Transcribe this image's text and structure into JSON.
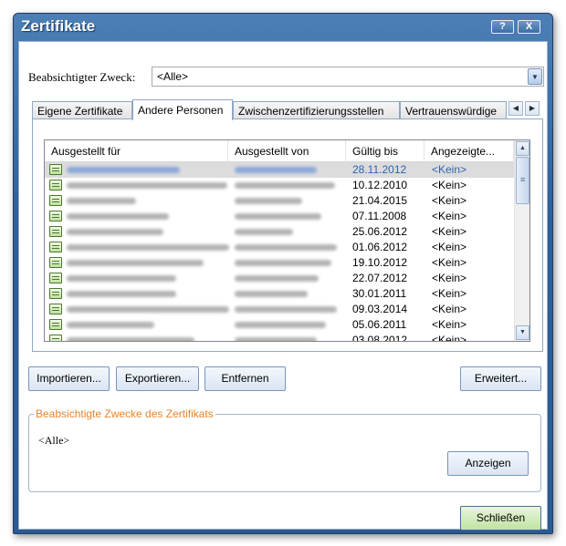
{
  "window": {
    "title": "Zertifikate",
    "help_btn": "?",
    "close_btn": "X"
  },
  "purpose": {
    "label": "Beabsichtigter Zweck:",
    "selected": "<Alle>"
  },
  "tabs": [
    {
      "label": "Eigene Zertifikate"
    },
    {
      "label": "Andere Personen"
    },
    {
      "label": "Zwischenzertifizierungsstellen"
    },
    {
      "label": "Vertrauenswürdige"
    }
  ],
  "list": {
    "columns": [
      "Ausgestellt für",
      "Ausgestellt von",
      "Gültig bis",
      "Angezeigte..."
    ],
    "rows": [
      {
        "valid_until": "28.11.2012",
        "friendly": "<Kein>"
      },
      {
        "valid_until": "10.12.2010",
        "friendly": "<Kein>"
      },
      {
        "valid_until": "21.04.2015",
        "friendly": "<Kein>"
      },
      {
        "valid_until": "07.11.2008",
        "friendly": "<Kein>"
      },
      {
        "valid_until": "25.06.2012",
        "friendly": "<Kein>"
      },
      {
        "valid_until": "01.06.2012",
        "friendly": "<Kein>"
      },
      {
        "valid_until": "19.10.2012",
        "friendly": "<Kein>"
      },
      {
        "valid_until": "22.07.2012",
        "friendly": "<Kein>"
      },
      {
        "valid_until": "30.01.2011",
        "friendly": "<Kein>"
      },
      {
        "valid_until": "09.03.2014",
        "friendly": "<Kein>"
      },
      {
        "valid_until": "05.06.2011",
        "friendly": "<Kein>"
      },
      {
        "valid_until": "03.08.2012",
        "friendly": "<Kein>"
      }
    ]
  },
  "buttons": {
    "import": "Importieren...",
    "export": "Exportieren...",
    "remove": "Entfernen",
    "advanced": "Erweitert...",
    "view": "Anzeigen",
    "close": "Schließen"
  },
  "purposes_group": {
    "title": "Beabsichtigte Zwecke des Zertifikats",
    "value": "<Alle>"
  },
  "colors": {
    "title_bar": "#2e5f99",
    "selected_text": "#2b62b8",
    "group_title": "#e5852a"
  }
}
